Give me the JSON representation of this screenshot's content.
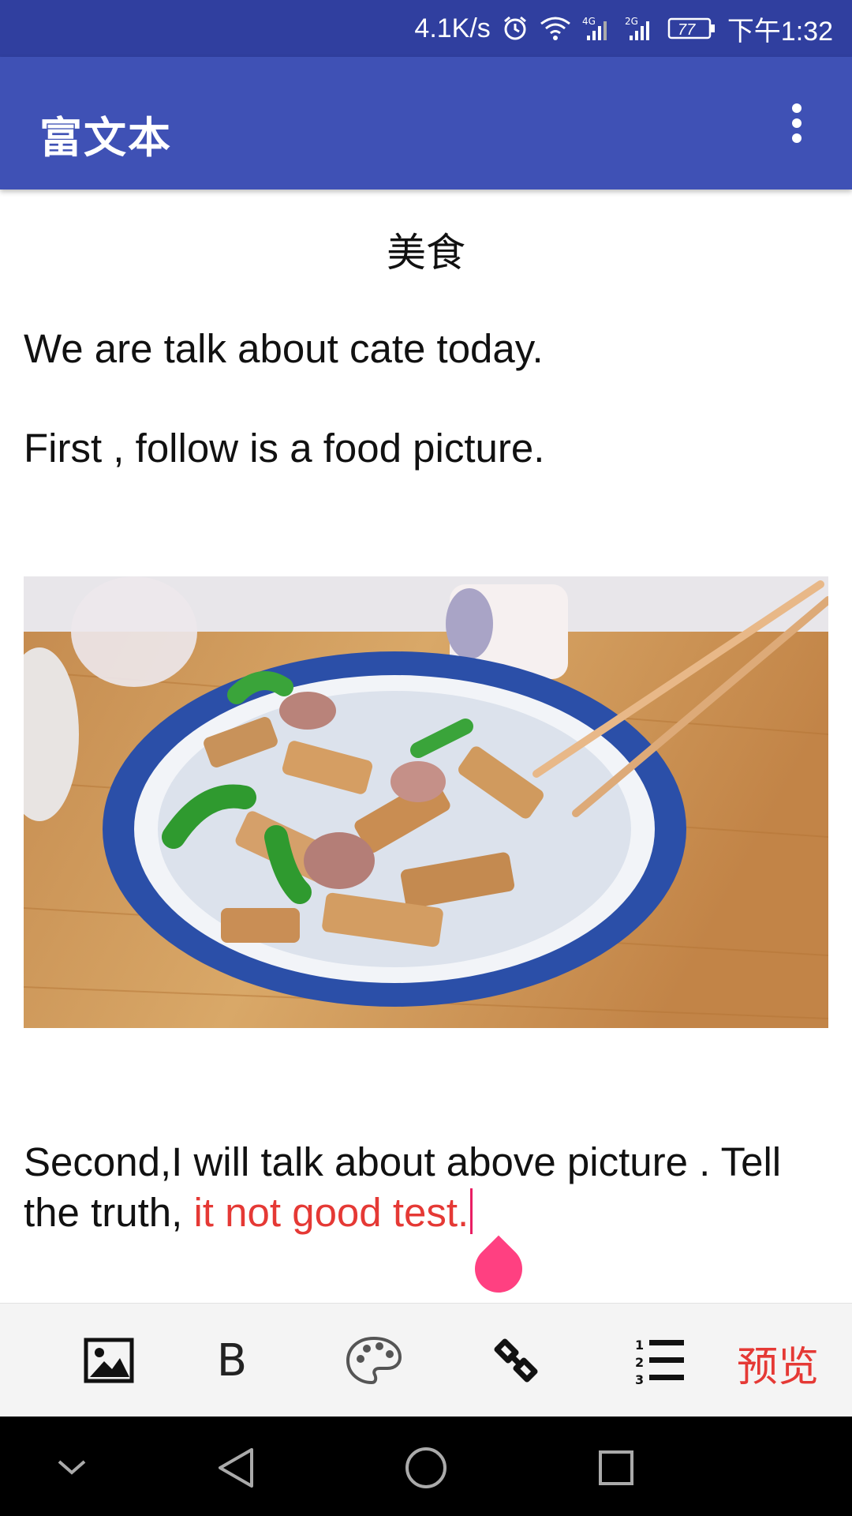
{
  "status_bar": {
    "speed": "4.1K/s",
    "net1": "4G",
    "net2": "2G",
    "battery": "77",
    "time": "下午1:32"
  },
  "app_bar": {
    "title": "富文本",
    "menu_icon": "more-vert-icon"
  },
  "editor": {
    "heading": "美食",
    "paragraphs": [
      "We are talk about cate today.",
      "First , follow is a food picture."
    ],
    "image_alt_icon": "food-photo",
    "final_paragraph": {
      "normal": "Second,I will talk about above picture . Tell the truth, ",
      "red": "it not good test."
    }
  },
  "toolbar": {
    "tools": [
      "image-icon",
      "bold-icon",
      "palette-icon",
      "link-icon",
      "numbered-list-icon"
    ],
    "bold_label": "B",
    "preview_label": "预览",
    "accent": "#E53935"
  },
  "nav_bar": {
    "buttons": [
      "hide-keyboard-icon",
      "back-icon",
      "home-icon",
      "recents-icon"
    ]
  },
  "colors": {
    "primary": "#3F51B5",
    "primary_dark": "#303F9F",
    "accent": "#FF4081"
  }
}
